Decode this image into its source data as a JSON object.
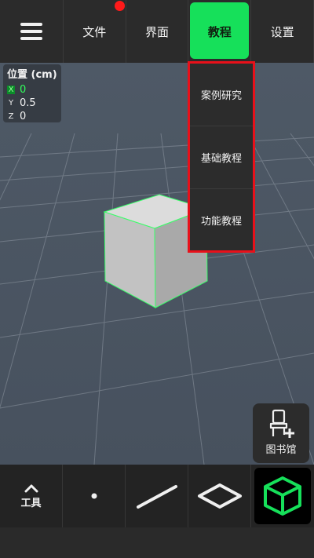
{
  "topbar": {
    "tabs": [
      {
        "label": "文件"
      },
      {
        "label": "界面"
      },
      {
        "label": "教程"
      },
      {
        "label": "设置"
      }
    ]
  },
  "position_panel": {
    "title": "位置 (cm)",
    "x": {
      "axis": "X",
      "value": "0"
    },
    "y": {
      "axis": "Y",
      "value": "0.5"
    },
    "z": {
      "axis": "Z",
      "value": "0"
    }
  },
  "dropdown": {
    "items": [
      {
        "label": "案例研究"
      },
      {
        "label": "基础教程"
      },
      {
        "label": "功能教程"
      }
    ]
  },
  "library": {
    "label": "图书馆"
  },
  "toolbar": {
    "tools_label": "工具"
  },
  "colors": {
    "accent": "#16e05a",
    "highlight_border": "#e8101a",
    "cube_edge": "#3bff6a"
  }
}
